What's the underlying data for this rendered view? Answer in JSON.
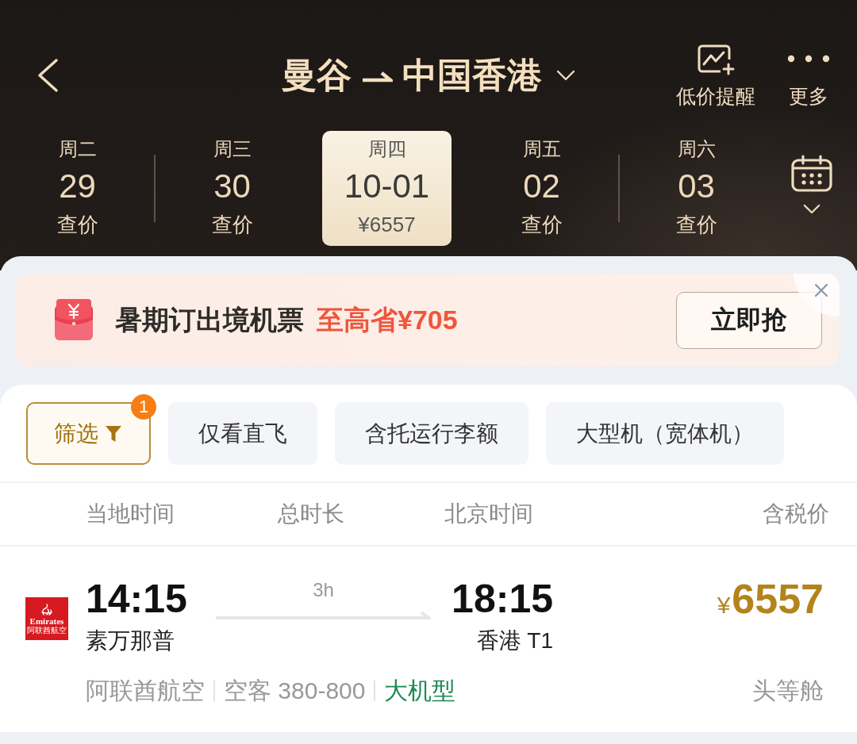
{
  "header": {
    "origin": "曼谷",
    "destination": "中国香港",
    "actions": [
      {
        "kind": "alert",
        "label": "低价提醒"
      },
      {
        "kind": "more",
        "label": "更多"
      }
    ]
  },
  "dates": [
    {
      "weekday": "周二",
      "day": "29",
      "price": "查价",
      "selected": false
    },
    {
      "weekday": "周三",
      "day": "30",
      "price": "查价",
      "selected": false
    },
    {
      "weekday": "周四",
      "day": "10-01",
      "price": "¥6557",
      "selected": true
    },
    {
      "weekday": "周五",
      "day": "02",
      "price": "查价",
      "selected": false
    },
    {
      "weekday": "周六",
      "day": "03",
      "price": "查价",
      "selected": false
    }
  ],
  "promo": {
    "title": "暑期订出境机票",
    "highlight": "至高省¥705",
    "button": "立即抢"
  },
  "filters": [
    {
      "kind": "filter",
      "label": "筛选",
      "badge": "1",
      "selected": true
    },
    {
      "kind": "chip",
      "label": "仅看直飞",
      "selected": false
    },
    {
      "kind": "chip",
      "label": "含托运行李额",
      "selected": false
    },
    {
      "kind": "chip",
      "label": "大型机（宽体机）",
      "selected": false
    }
  ],
  "columns": [
    "当地时间",
    "总时长",
    "北京时间",
    "含税价"
  ],
  "flights": [
    {
      "logo_name": "Emirates",
      "logo_subname": "阿联酋航空",
      "depart_time": "14:15",
      "depart_airport": "素万那普",
      "duration": "3h",
      "arrive_time": "18:15",
      "arrive_airport": "香港 T1",
      "currency": "¥",
      "price": "6557",
      "airline": "阿联酋航空",
      "aircraft": "空客 380-800",
      "tag": "大机型",
      "cabin": "头等舱"
    }
  ]
}
